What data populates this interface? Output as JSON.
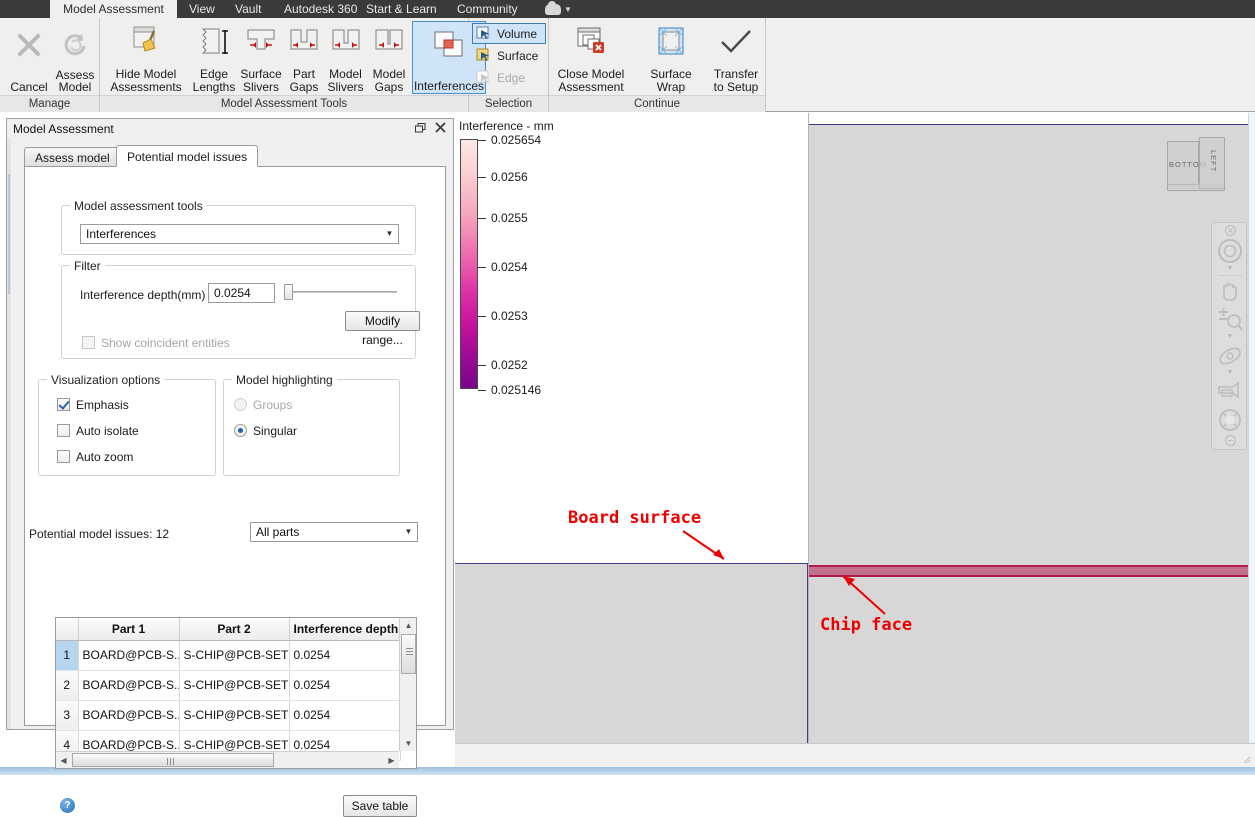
{
  "ribbon": {
    "tabs": [
      {
        "label": "Model Assessment",
        "active": true
      },
      {
        "label": "View",
        "active": false
      },
      {
        "label": "Vault",
        "active": false
      },
      {
        "label": "Autodesk 360",
        "active": false
      },
      {
        "label": "Start & Learn",
        "active": false
      },
      {
        "label": "Community",
        "active": false
      }
    ],
    "panels": [
      {
        "title": "Manage"
      },
      {
        "title": "Model Assessment Tools"
      },
      {
        "title": "Selection"
      },
      {
        "title": "Continue"
      }
    ],
    "manage": [
      {
        "label": "Cancel",
        "icon": "cancel-x-icon",
        "enabled": false
      },
      {
        "label": "Assess Model",
        "icon": "refresh-icon",
        "enabled": false
      }
    ],
    "tools": [
      {
        "label": "Hide Model Assessments",
        "icon": "broom-icon",
        "selected": false
      },
      {
        "label": "Edge Lengths",
        "icon": "edge-length-icon",
        "selected": false
      },
      {
        "label": "Surface Slivers",
        "icon": "surface-sliver-icon",
        "selected": false
      },
      {
        "label": "Part Gaps",
        "icon": "part-gap-icon",
        "selected": false
      },
      {
        "label": "Model Slivers",
        "icon": "model-sliver-icon",
        "selected": false
      },
      {
        "label": "Model Gaps",
        "icon": "model-gap-icon",
        "selected": false
      },
      {
        "label": "Interferences",
        "icon": "interference-icon",
        "selected": true
      }
    ],
    "selection": [
      {
        "label": "Volume",
        "icon": "volume-select-icon",
        "state": "selected"
      },
      {
        "label": "Surface",
        "icon": "surface-select-icon",
        "state": "normal"
      },
      {
        "label": "Edge",
        "icon": "edge-select-icon",
        "state": "disabled"
      }
    ],
    "continue": [
      {
        "label": "Close Model Assessment",
        "icon": "close-assessment-icon"
      },
      {
        "label": "Surface Wrap",
        "icon": "surface-wrap-icon"
      },
      {
        "label": "Transfer to Setup",
        "icon": "checkmark-icon"
      }
    ]
  },
  "dialog": {
    "title": "Model Assessment",
    "window_buttons": [
      "restore-icon",
      "close-icon"
    ],
    "tabs": [
      {
        "label": "Assess model",
        "active": false
      },
      {
        "label": "Potential model issues",
        "active": true
      }
    ],
    "tools_group": {
      "caption": "Model assessment tools",
      "selected": "Interferences"
    },
    "filter_group": {
      "caption": "Filter",
      "depth_label": "Interference depth(mm)",
      "depth_value": "0.0254",
      "modify_range_label": "Modify range...",
      "show_coincident_label": "Show coincident entities",
      "show_coincident_checked": false,
      "show_coincident_enabled": false
    },
    "visualization_group": {
      "caption": "Visualization options",
      "options": [
        {
          "label": "Emphasis",
          "checked": true
        },
        {
          "label": "Auto isolate",
          "checked": false
        },
        {
          "label": "Auto zoom",
          "checked": false
        }
      ]
    },
    "highlighting_group": {
      "caption": "Model highlighting",
      "options": [
        {
          "label": "Groups",
          "selected": false,
          "enabled": false
        },
        {
          "label": "Singular",
          "selected": true,
          "enabled": true
        }
      ]
    },
    "issues_label": "Potential model issues: 12",
    "parts_filter": "All parts",
    "table": {
      "columns": [
        "",
        "Part 1",
        "Part 2",
        "Interference depth"
      ],
      "rows": [
        {
          "n": "1",
          "part1": "BOARD@PCB-S...",
          "part2": "S-CHIP@PCB-SET",
          "depth": "0.0254",
          "selected": true
        },
        {
          "n": "2",
          "part1": "BOARD@PCB-S...",
          "part2": "S-CHIP@PCB-SET",
          "depth": "0.0254",
          "selected": false
        },
        {
          "n": "3",
          "part1": "BOARD@PCB-S...",
          "part2": "S-CHIP@PCB-SET",
          "depth": "0.0254",
          "selected": false
        },
        {
          "n": "4",
          "part1": "BOARD@PCB-S...",
          "part2": "S-CHIP@PCB-SET",
          "depth": "0.0254",
          "selected": false
        }
      ]
    },
    "help_icon": "help-icon",
    "save_table_label": "Save table"
  },
  "legend": {
    "title": "Interference - mm",
    "ticks": [
      "0.025654",
      "0.0256",
      "0.0255",
      "0.0254",
      "0.0253",
      "0.0252",
      "0.025146"
    ],
    "gradient_top": "#fbe9e5",
    "gradient_bottom": "#78068a"
  },
  "chart_data": {
    "type": "heatmap",
    "title": "Interference - mm",
    "colorbar_min": 0.025146,
    "colorbar_max": 0.025654,
    "tick_values": [
      0.025654,
      0.0256,
      0.0255,
      0.0254,
      0.0253,
      0.0252,
      0.025146
    ],
    "tick_labels": [
      "0.025654",
      "0.0256",
      "0.0255",
      "0.0254",
      "0.0253",
      "0.0252",
      "0.025146"
    ],
    "unit": "mm",
    "colormap": [
      "#fbe9e5",
      "#f5a6bd",
      "#ee6cae",
      "#dd2fa6",
      "#c2109c",
      "#78068a"
    ],
    "legend_position": "left",
    "grid": false
  },
  "viewport": {
    "viewcube": {
      "front_face": "BOTTOM",
      "side_face": "LEFT"
    },
    "navbar_icons": [
      "navbar-close-icon",
      "steering-wheel-icon",
      "pan-hand-icon",
      "zoom-icon",
      "orbit-icon",
      "rewind-camera-icon",
      "fit-all-icon",
      "navbar-minimize-icon"
    ],
    "annotations": [
      {
        "text": "Board surface",
        "color": "#ee0000"
      },
      {
        "text": "Chip face",
        "color": "#ee0000"
      }
    ]
  }
}
